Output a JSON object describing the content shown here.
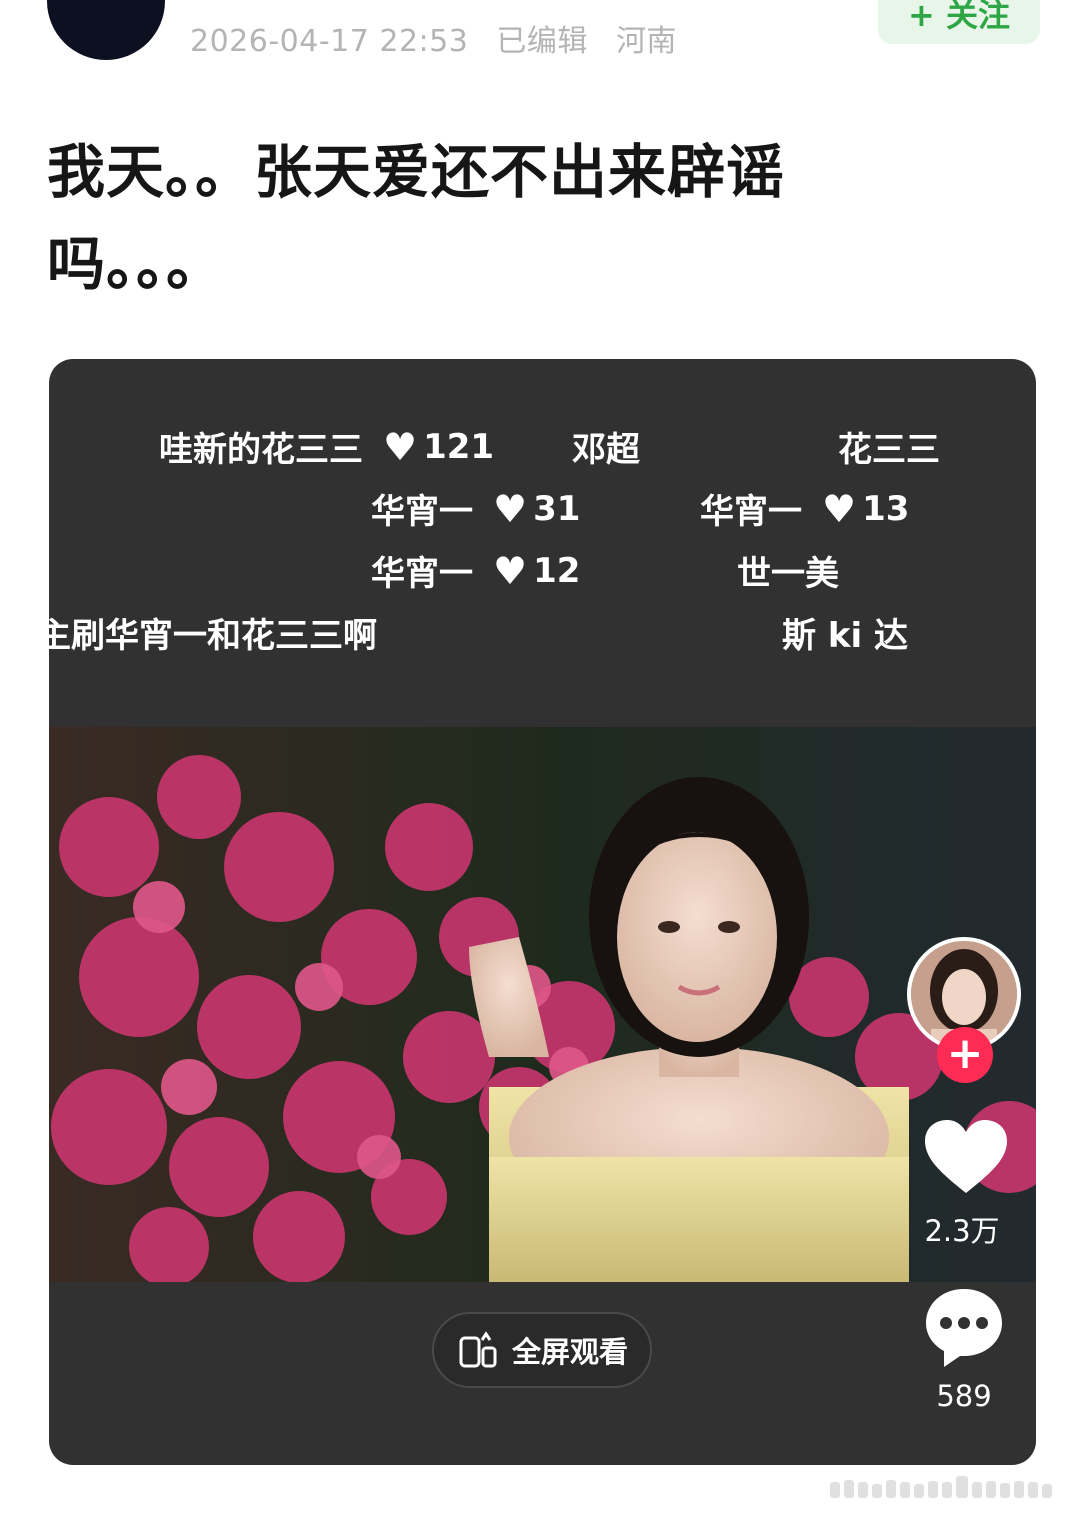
{
  "header": {
    "timestamp": "2026-04-17 22:53",
    "edited_label": "已编辑",
    "location": "河南",
    "follow_label": "+ 关注"
  },
  "post": {
    "line1": "我天。。张天爱还不出来辟谣",
    "line2": "吗。。。"
  },
  "danmaku": [
    {
      "text": "哇新的花三三",
      "likes": "121"
    },
    {
      "text": "邓超"
    },
    {
      "text": "花三三"
    },
    {
      "text": "华宵一",
      "likes": "31"
    },
    {
      "text": "华宵一",
      "likes": "13"
    },
    {
      "text": "华宵一",
      "likes": "12"
    },
    {
      "text": "世一美"
    },
    {
      "text": "主刷华宵一和花三三啊"
    },
    {
      "text": "斯 ki 达"
    }
  ],
  "video": {
    "like_count": "2.3万",
    "comment_count": "589",
    "fullscreen_label": "全屏观看"
  },
  "colors": {
    "card_bg": "#313131",
    "follow_green": "#2fa646",
    "plus_red": "#fe2c55"
  },
  "icons": [
    "heart-icon",
    "plus-icon",
    "comment-icon",
    "fullscreen-icon"
  ]
}
